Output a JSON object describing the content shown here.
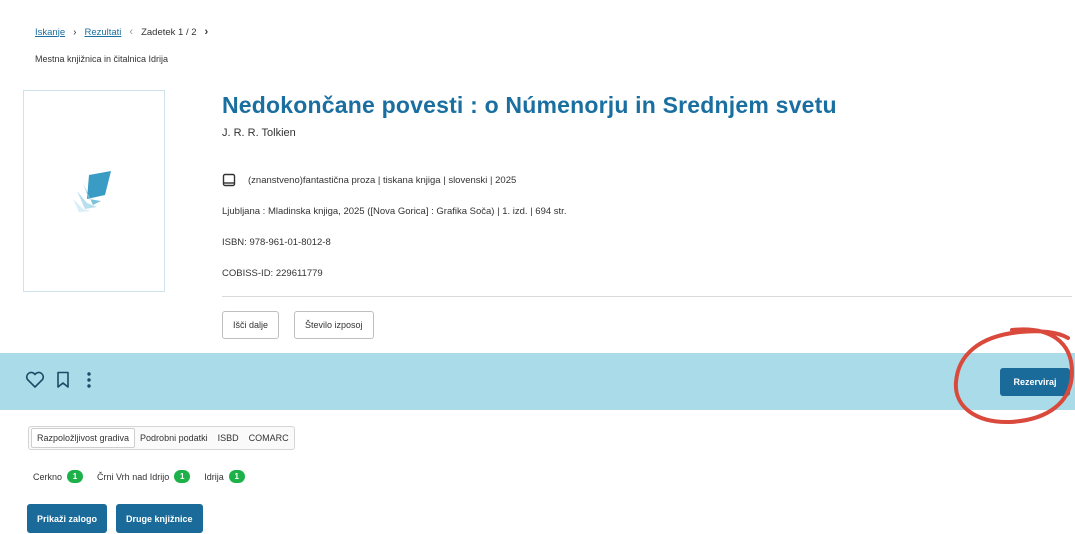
{
  "breadcrumb": {
    "search": "Iskanje",
    "results": "Rezultati",
    "record": "Zadetek 1 / 2"
  },
  "library_name": "Mestna knjižnica in čitalnica Idrija",
  "book": {
    "title": "Nedokončane povesti : o Númenorju in Srednjem svetu",
    "author": "J. R. R. Tolkien",
    "material": "(znanstveno)fantastična proza | tiskana knjiga | slovenski | 2025",
    "publication": "Ljubljana : Mladinska knjiga, 2025 ([Nova Gorica] : Grafika Soča) | 1. izd. | 694 str.",
    "isbn": "ISBN: 978-961-01-8012-8",
    "cobiss_id": "COBISS-ID: 229611779"
  },
  "actions": {
    "search_further": "Išči dalje",
    "loan_count": "Število izposoj",
    "reserve": "Rezerviraj"
  },
  "tabs": [
    {
      "label": "Razpoložljivost gradiva"
    },
    {
      "label": "Podrobni podatki"
    },
    {
      "label": "ISBD"
    },
    {
      "label": "COMARC"
    }
  ],
  "availability": [
    {
      "location": "Cerkno",
      "count": "1"
    },
    {
      "location": "Črni Vrh nad Idrijo",
      "count": "1"
    },
    {
      "location": "Idrija",
      "count": "1"
    }
  ],
  "bottom_buttons": {
    "show_stock": "Prikaži zalogo",
    "other_libraries": "Druge knjižnice"
  },
  "icons": {
    "cover_placeholder": "book-pages-icon",
    "material_type": "book-icon",
    "favorite": "heart-icon",
    "bookmark": "bookmark-icon",
    "more": "more-vertical-icon"
  },
  "colors": {
    "accent": "#1a6fa0",
    "primary_button": "#1a6b99",
    "action_bar": "#a9dbe8",
    "badge": "#1db14a",
    "annotation": "#d94a3d"
  }
}
